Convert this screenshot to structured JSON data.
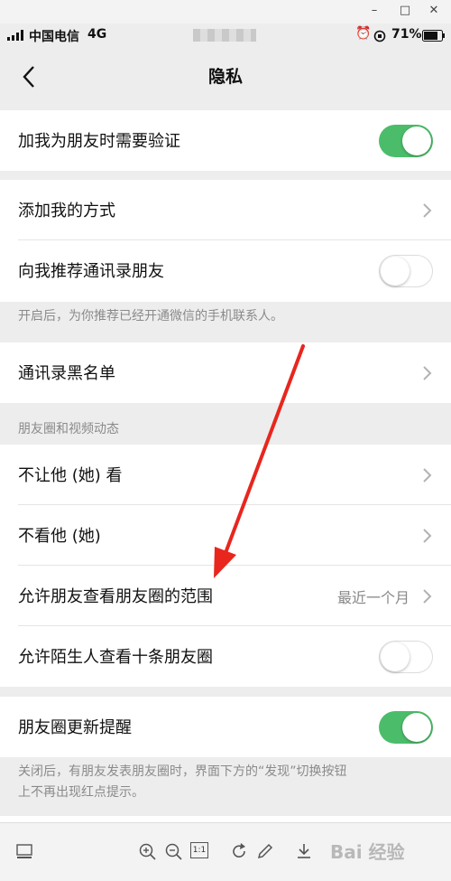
{
  "window": {
    "minimize": "–",
    "maximize": "□",
    "close": "✕"
  },
  "status_bar": {
    "carrier": "中国电信",
    "network": "4G",
    "battery": "71%"
  },
  "nav": {
    "title": "隐私"
  },
  "rows": {
    "verify": {
      "label": "加我为朋友时需要验证",
      "toggle": true
    },
    "add_methods": {
      "label": "添加我的方式"
    },
    "recommend_contacts": {
      "label": "向我推荐通讯录朋友",
      "toggle": false
    },
    "recommend_hint": "开启后，为你推荐已经开通微信的手机联系人。",
    "blacklist": {
      "label": "通讯录黑名单"
    },
    "moments_header": "朋友圈和视频动态",
    "hide_from": {
      "label": "不让他 (她) 看"
    },
    "dont_see": {
      "label": "不看他 (她)"
    },
    "moments_range": {
      "label": "允许朋友查看朋友圈的范围",
      "value": "最近一个月"
    },
    "stranger_ten": {
      "label": "允许陌生人查看十条朋友圈",
      "toggle": false
    },
    "moments_update": {
      "label": "朋友圈更新提醒",
      "toggle": true
    },
    "update_hint_line1": "关闭后，有朋友发表朋友圈时，界面下方的“发现”切换按钮",
    "update_hint_line2": "上不再出现红点提示。"
  },
  "viewer_toolbar": {
    "fit_label": "1:1"
  },
  "watermark": "Bai 经验",
  "colors": {
    "toggle_on": "#4bbd6a",
    "annotation_arrow": "#e8261e"
  }
}
